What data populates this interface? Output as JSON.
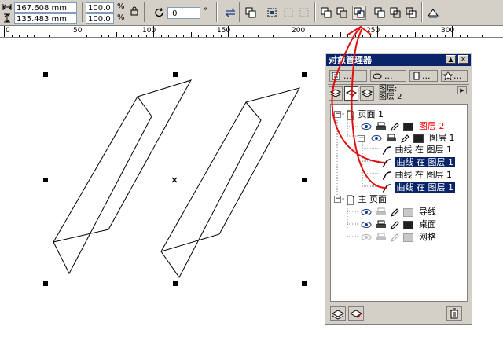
{
  "propbar": {
    "width": "167.608 mm",
    "height": "135.483 mm",
    "scale_x": "100.0",
    "scale_y": "100.0",
    "percent": "%",
    "rotation": ".0",
    "degree": "°"
  },
  "ruler": {
    "ticks": [
      "0",
      "50",
      "100",
      "150",
      "200",
      "250",
      "300"
    ]
  },
  "docker": {
    "title": "对象管理器",
    "tab_dots": "...",
    "layer_header": [
      "图层:",
      "图层 2"
    ],
    "tree": {
      "page1": "页面 1",
      "layer2": "图层 2",
      "layer1": "图层 1",
      "curves": [
        "曲线 在 图层 1",
        "曲线 在 图层 1",
        "曲线 在 图层 1",
        "曲线 在 图层 1"
      ],
      "master": "主 页面",
      "guides": "导线",
      "desktop": "桌面",
      "grid": "网格"
    }
  },
  "colors": {
    "selection": "#0a246a",
    "active_layer": "#ff0000",
    "annotation": "#e01010"
  }
}
